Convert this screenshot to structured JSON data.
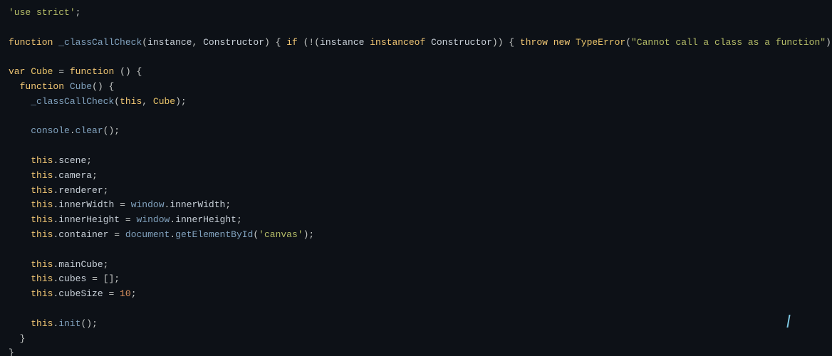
{
  "code": {
    "lines": [
      {
        "id": 1,
        "content": "'use strict';"
      },
      {
        "id": 2,
        "content": ""
      },
      {
        "id": 3,
        "content": "function _classCallCheck(instance, Constructor) { if (!(instance instanceof Constructor)) { throw new TypeError(\"Cannot call a class as a function\"); } }"
      },
      {
        "id": 4,
        "content": ""
      },
      {
        "id": 5,
        "content": "var Cube = function () {"
      },
      {
        "id": 6,
        "content": "  function Cube() {"
      },
      {
        "id": 7,
        "content": "    _classCallCheck(this, Cube);"
      },
      {
        "id": 8,
        "content": ""
      },
      {
        "id": 9,
        "content": "    console.clear();"
      },
      {
        "id": 10,
        "content": ""
      },
      {
        "id": 11,
        "content": "    this.scene;"
      },
      {
        "id": 12,
        "content": "    this.camera;"
      },
      {
        "id": 13,
        "content": "    this.renderer;"
      },
      {
        "id": 14,
        "content": "    this.innerWidth = window.innerWidth;"
      },
      {
        "id": 15,
        "content": "    this.innerHeight = window.innerHeight;"
      },
      {
        "id": 16,
        "content": "    this.container = document.getElementById('canvas');"
      },
      {
        "id": 17,
        "content": ""
      },
      {
        "id": 18,
        "content": "    this.mainCube;"
      },
      {
        "id": 19,
        "content": "    this.cubes = [];"
      },
      {
        "id": 20,
        "content": "    this.cubeSize = 10;"
      },
      {
        "id": 21,
        "content": ""
      },
      {
        "id": 22,
        "content": "    this.init();"
      },
      {
        "id": 23,
        "content": "  }"
      },
      {
        "id": 24,
        "content": "}"
      }
    ]
  }
}
